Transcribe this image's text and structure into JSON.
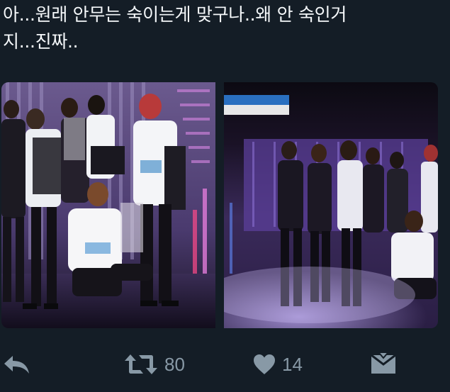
{
  "tweet": {
    "text": "아...원래 안무는 숙이는게 맞구나..왜 안 숙인거\n지...진짜.."
  },
  "media": {
    "left_photo": {
      "label": ""
    },
    "right_photo": {
      "label": ""
    }
  },
  "actions": {
    "reply": {
      "icon": "reply-icon"
    },
    "retweet": {
      "icon": "retweet-icon",
      "count": "80"
    },
    "like": {
      "icon": "heart-icon",
      "count": "14"
    },
    "dm": {
      "icon": "envelope-icon"
    }
  },
  "colors": {
    "background": "#141d26",
    "text": "#f5f8fa",
    "icon": "#8899a6"
  }
}
